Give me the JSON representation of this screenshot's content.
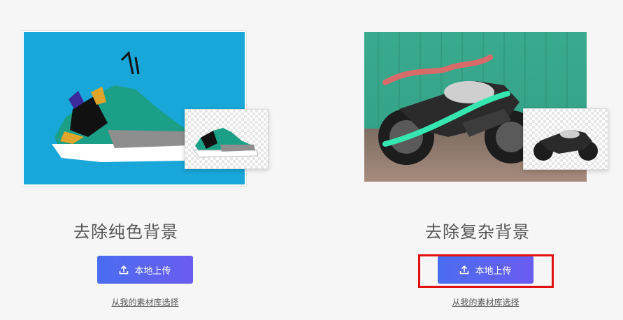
{
  "cards": [
    {
      "title": "去除纯色背景",
      "upload_label": "本地上传",
      "library_link": "从我的素材库选择",
      "image_subject": "sneaker-on-solid-background"
    },
    {
      "title": "去除复杂背景",
      "upload_label": "本地上传",
      "library_link": "从我的素材库选择",
      "image_subject": "motorcycle-on-complex-background"
    }
  ],
  "colors": {
    "page_bg": "#f6f6f6",
    "button_gradient_start": "#4a6df0",
    "button_gradient_end": "#6a5cf0",
    "highlight": "#e01010",
    "solid_bg": "#18a7d8"
  },
  "icons": {
    "upload": "upload-icon"
  }
}
